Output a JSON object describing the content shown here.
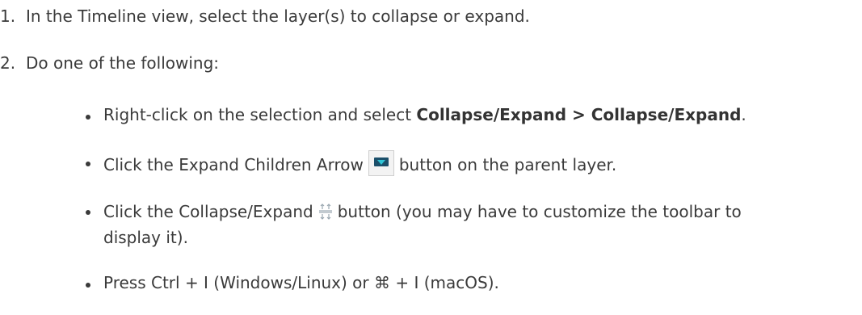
{
  "steps": [
    {
      "num": "1.",
      "text": "In the Timeline view, select the layer(s) to collapse or expand."
    },
    {
      "num": "2.",
      "text": "Do one of the following:"
    }
  ],
  "bullets": {
    "b1": {
      "pre": "Right-click on the selection and select ",
      "bold": "Collapse/Expand > Collapse/Expand",
      "post": "."
    },
    "b2": {
      "pre": "Click the Expand Children Arrow",
      "post": "button on the parent layer.",
      "icon": "expand-children-arrow-icon"
    },
    "b3": {
      "pre": "Click the Collapse/Expand",
      "post": "button (you may have to customize the toolbar to",
      "post2": "display it).",
      "icon": "collapse-expand-icon"
    },
    "b4": {
      "pre": "Press Ctrl + I (Windows/Linux) or ",
      "cmd": "⌘",
      "post": " + I (macOS)."
    }
  },
  "colors": {
    "text": "#3a3a3a",
    "icon_dark": "#1b4f6a",
    "icon_accent": "#2ec5d6"
  }
}
